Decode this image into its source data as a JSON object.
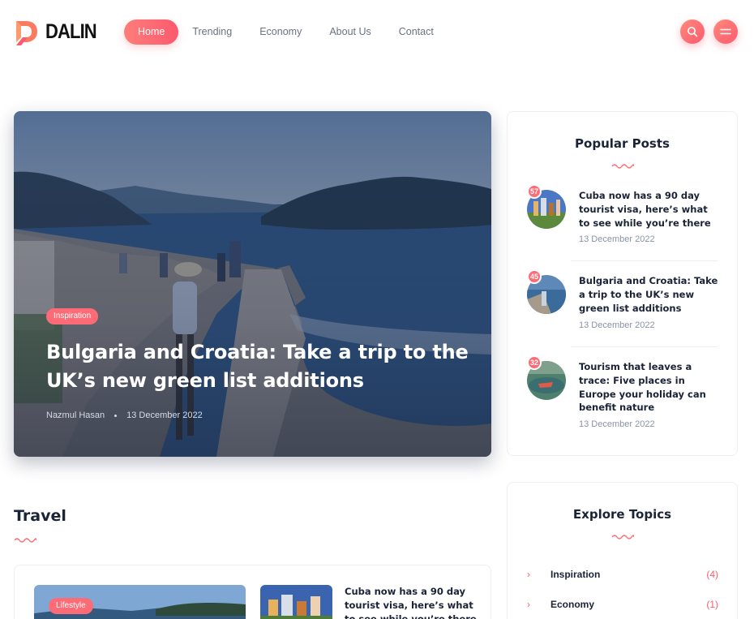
{
  "brand": {
    "name": "DALIN",
    "accent": "#fc5a6e",
    "accent_light": "#fe7e7a",
    "text_dark": "#1b2336"
  },
  "nav": {
    "items": [
      {
        "label": "Home",
        "active": true
      },
      {
        "label": "Trending",
        "active": false
      },
      {
        "label": "Economy",
        "active": false
      },
      {
        "label": "About Us",
        "active": false
      },
      {
        "label": "Contact",
        "active": false
      }
    ],
    "search_icon": "search-icon",
    "menu_icon": "hamburger-menu-icon"
  },
  "hero": {
    "category": "Inspiration",
    "title": "Bulgaria and Croatia: Take a trip to the UK’s new green list additions",
    "author": "Nazmul Hasan",
    "date": "13 December 2022"
  },
  "popular_posts": {
    "heading": "Popular Posts",
    "items": [
      {
        "count": "57",
        "title": "Cuba now has a 90 day tourist visa, here’s what to see while you’re there",
        "date": "13 December 2022"
      },
      {
        "count": "45",
        "title": "Bulgaria and Croatia: Take a trip to the UK’s new green list additions",
        "date": "13 December 2022"
      },
      {
        "count": "32",
        "title": "Tourism that leaves a trace: Five places in Europe your holiday can benefit nature",
        "date": "13 December 2022"
      }
    ]
  },
  "explore_topics": {
    "heading": "Explore Topics",
    "items": [
      {
        "name": "Inspiration",
        "count": "(4)"
      },
      {
        "name": "Economy",
        "count": "(1)"
      }
    ]
  },
  "travel": {
    "heading": "Travel",
    "featured_category": "Lifestyle",
    "side_post_title": "Cuba now has a 90 day tourist visa, here’s what to see while you’re there"
  }
}
